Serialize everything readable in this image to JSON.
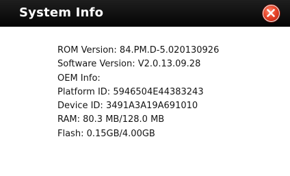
{
  "window": {
    "title": "System Info",
    "close_icon": "close-icon",
    "colors": {
      "title_bar": "#0b0b0b",
      "title_text": "#ffffff",
      "close_button": "#e8452a",
      "body": "#ffffff",
      "text": "#141414"
    }
  },
  "info": [
    "ROM Version: 84.PM.D-5.020130926",
    "Software Version: V2.0.13.09.28",
    "OEM Info:",
    "Platform ID: 5946504E44383243",
    "Device ID: 3491A3A19A691010",
    "RAM: 80.3 MB/128.0 MB",
    "Flash: 0.15GB/4.00GB"
  ]
}
